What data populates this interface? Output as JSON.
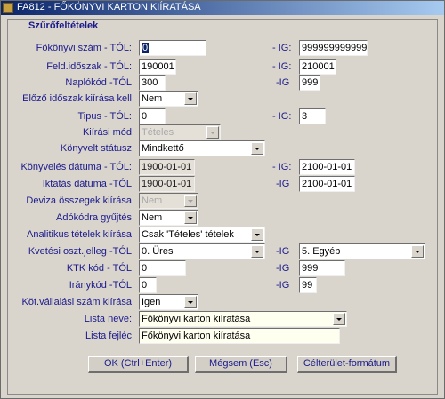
{
  "window": {
    "title": "FA812 - FŐKÖNYVI KARTON KIÍRATÁSA"
  },
  "section_title": "Szűrőfeltételek",
  "rows": {
    "fokonyvi_szam": {
      "label": "Főkönyvi szám - TÓL:",
      "from": "0",
      "ig_label": "- IG:",
      "to": "999999999999"
    },
    "feld_idoszak": {
      "label": "Feld.időszak - TÓL:",
      "from": "190001",
      "ig_label": "- IG:",
      "to": "210001"
    },
    "naplokod": {
      "label": "Naplókód -TÓL",
      "from": "300",
      "ig_label": "-IG",
      "to": "999"
    },
    "elozo_idoszak": {
      "label": "Előző időszak kiírása kell",
      "value": "Nem"
    },
    "tipus": {
      "label": "Tipus - TÓL:",
      "from": "0",
      "ig_label": "- IG:",
      "to": "3"
    },
    "kiirasi_mod": {
      "label": "Kiírási mód",
      "value": "Tételes"
    },
    "konyvelt_statusz": {
      "label": "Könyvelt státusz",
      "value": "Mindkettő"
    },
    "konyveles_datuma": {
      "label": "Könyvelés dátuma - TÓL:",
      "from": "1900-01-01",
      "ig_label": "- IG:",
      "to": "2100-01-01"
    },
    "iktatas_datuma": {
      "label": "Iktatás dátuma -TÓL",
      "from": "1900-01-01",
      "ig_label": "-IG",
      "to": "2100-01-01"
    },
    "deviza_osszegek": {
      "label": "Deviza összegek kiírása",
      "value": "Nem"
    },
    "adokodra_gyujtes": {
      "label": "Adókódra gyűjtés",
      "value": "Nem"
    },
    "analitikus_tetelek": {
      "label": "Analitikus tételek kiírása",
      "value": "Csak 'Tételes' tételek"
    },
    "kvetesi_oszt": {
      "label": "Kvetési oszt.jelleg -TÓL",
      "from": "0. Üres",
      "ig_label": "-IG",
      "to": "5. Egyéb"
    },
    "ktk_kod": {
      "label": "KTK kód - TÓL",
      "from": "0",
      "ig_label": "-IG",
      "to": "999"
    },
    "iranykod": {
      "label": "Iránykód -TÓL",
      "from": "0",
      "ig_label": "-IG",
      "to": "99"
    },
    "kot_vallalasi": {
      "label": "Köt.vállalási szám kiírása",
      "value": "Igen"
    },
    "lista_neve": {
      "label": "Lista neve:",
      "value": "Főkönyvi karton kiíratása"
    },
    "lista_fejlec": {
      "label": "Lista fejléc",
      "value": "Főkönyvi karton kiíratása"
    }
  },
  "buttons": {
    "ok": "OK (Ctrl+Enter)",
    "cancel": "Mégsem (Esc)",
    "target_format": "Célterület-formátum"
  }
}
